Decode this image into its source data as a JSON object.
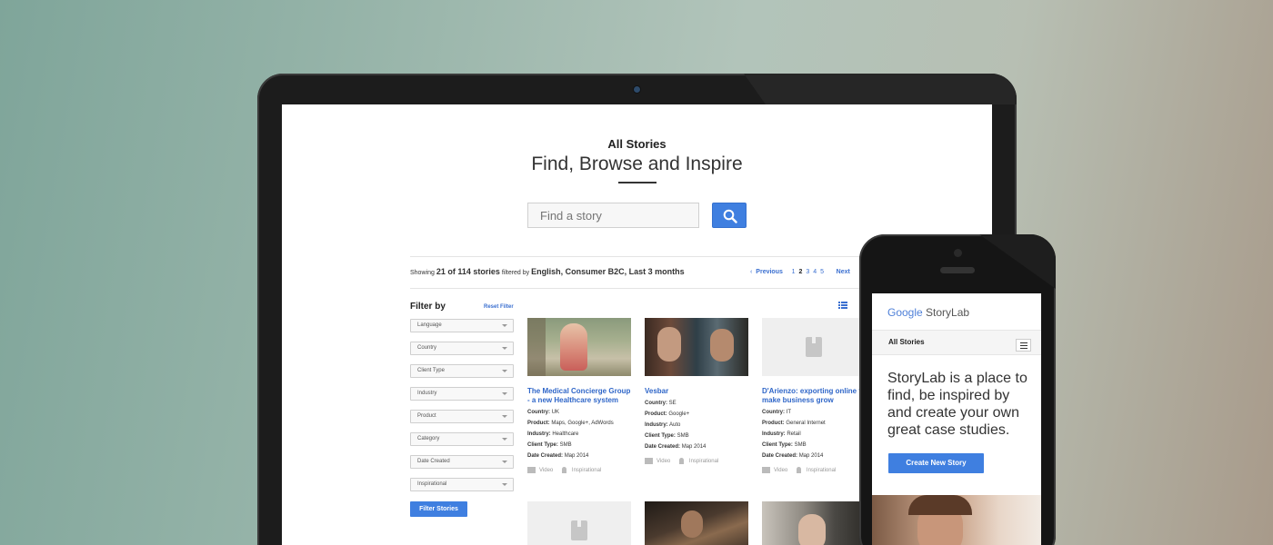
{
  "header": {
    "title": "All Stories",
    "subtitle": "Find, Browse and Inspire"
  },
  "search": {
    "placeholder": "Find a story",
    "button_icon": "search-icon"
  },
  "results": {
    "showing_prefix": "Showing",
    "count": "21 of 114 stories",
    "filtered_by": "filtered by",
    "filters": "English, Consumer B2C, Last 3 months"
  },
  "pagination": {
    "prev": "Previous",
    "pages": [
      "1",
      "2",
      "3",
      "4",
      "5"
    ],
    "current": "2",
    "next": "Next"
  },
  "filter": {
    "title": "Filter by",
    "reset": "Reset Filter",
    "selects": [
      "Language",
      "Country",
      "Client Type",
      "Industry",
      "Product",
      "Category",
      "Date Created",
      "Inspirational"
    ],
    "button": "Filter Stories"
  },
  "cards": [
    {
      "title": "The Medical Concierge Group - a new Healthcare system",
      "country": "UK",
      "product": "Maps, Google+, AdWords",
      "industry": "Healthcare",
      "client_type": "SMB",
      "date": "Map 2014",
      "tag1": "Video",
      "tag2": "Inspirational"
    },
    {
      "title": "Vesbar",
      "country": "SE",
      "product": "Google+",
      "industry": "Auto",
      "client_type": "SMB",
      "date": "Map 2014",
      "tag1": "Video",
      "tag2": "Inspirational"
    },
    {
      "title": "D'Arienzo: exporting online to make business grow",
      "country": "IT",
      "product": "General Internet",
      "industry": "Retail",
      "client_type": "SMB",
      "date": "Map 2014",
      "tag1": "Video",
      "tag2": "Inspirational"
    }
  ],
  "labels": {
    "country": "Country:",
    "product": "Product:",
    "industry": "Industry:",
    "client_type": "Client Type:",
    "date": "Date Created:"
  },
  "mobile": {
    "logo": "Google",
    "logo_product": "StoryLab",
    "nav_title": "All Stories",
    "headline": "StoryLab is a place to find, be inspired by and create your own great case studies.",
    "cta": "Create New Story"
  },
  "colors": {
    "accent": "#3f7fe0",
    "link": "#2f66c8"
  }
}
